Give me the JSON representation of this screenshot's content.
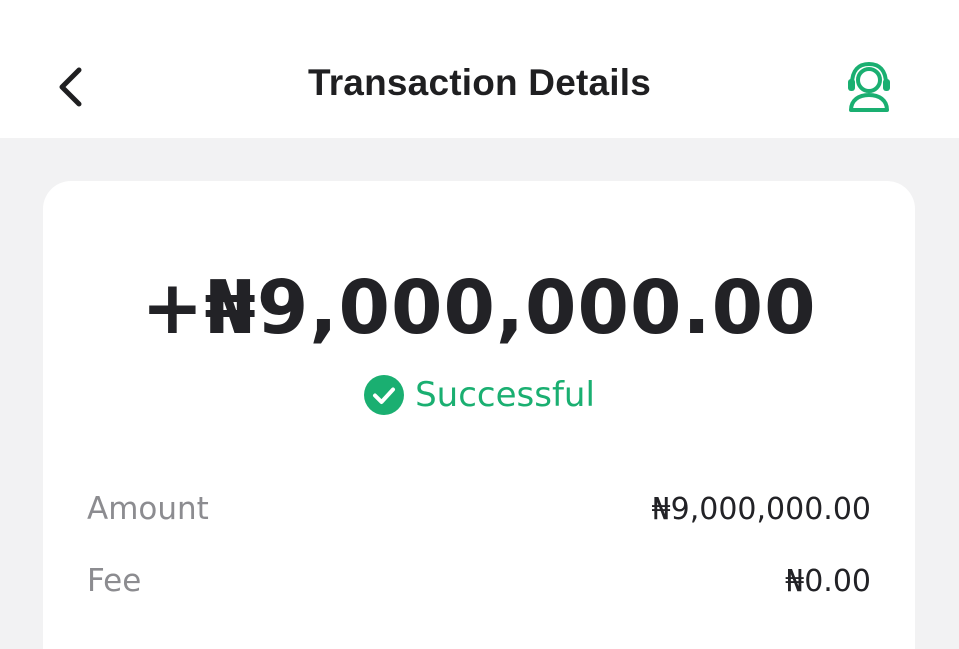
{
  "header": {
    "title": "Transaction Details",
    "back_icon": "chevron-left-icon",
    "support_icon": "customer-support-headset-icon"
  },
  "transaction": {
    "amount_display": "+₦9,000,000.00",
    "status_label": "Successful",
    "status_icon": "check-circle-icon",
    "details": {
      "amount_label": "Amount",
      "amount_value": "₦9,000,000.00",
      "fee_label": "Fee",
      "fee_value": "₦0.00"
    }
  },
  "colors": {
    "accent_green": "#1aaf71",
    "text_primary": "#222226",
    "text_muted": "#8c8c90",
    "background": "#f2f2f3",
    "card": "#ffffff"
  }
}
